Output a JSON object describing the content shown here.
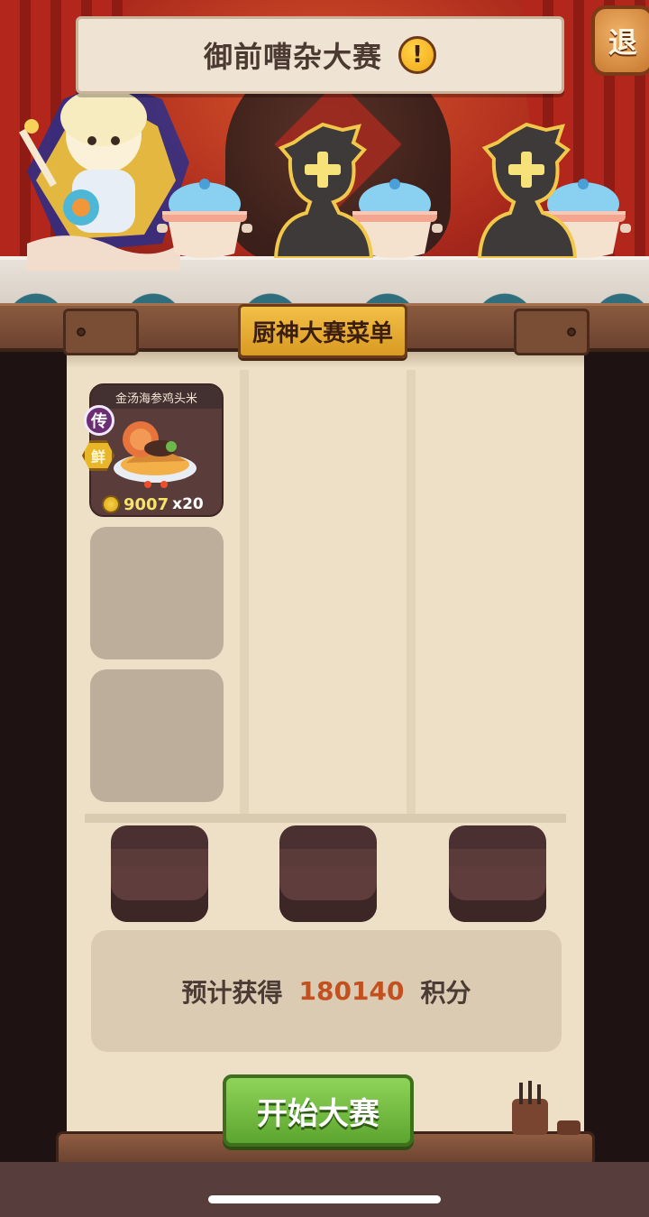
{
  "header": {
    "title": "御前嘈杂大赛",
    "alert_symbol": "!",
    "quit_label": "退"
  },
  "stage": {
    "participants": [
      {
        "state": "filled",
        "avatar": "chef-character"
      },
      {
        "state": "empty",
        "add_symbol": "+"
      },
      {
        "state": "empty",
        "add_symbol": "+"
      }
    ]
  },
  "menu": {
    "tab_label": "厨神大赛菜单",
    "dishes": [
      {
        "name": "金汤海参鸡头米",
        "rarity_badge": "传",
        "trait_badge": "鲜",
        "price": "9007",
        "quantity": "x20"
      }
    ],
    "empty_slots": 2
  },
  "judges": {
    "seats": 3
  },
  "score": {
    "prefix": "预计获得",
    "value": "180140",
    "suffix": "积分"
  },
  "actions": {
    "start_label": "开始大赛"
  },
  "colors": {
    "accent_green": "#5ca52e",
    "score_orange": "#c2511f",
    "tab_gold": "#f3c047",
    "board_bg": "#ede0c6"
  }
}
